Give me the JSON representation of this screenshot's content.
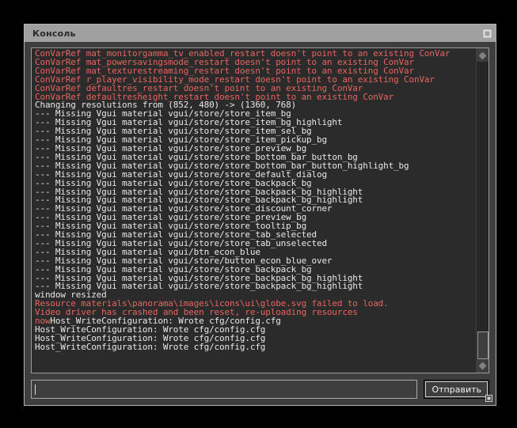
{
  "window": {
    "title": "Консоль",
    "titlebar_color": "#a0a0a0",
    "body_color": "#3e3e3e",
    "log_bg_color": "#2b2b2b",
    "error_color": "#e8645f",
    "text_color": "#e8e8e8",
    "restore_button_icon": "restore-window-icon",
    "resize_grip_icon": "resize-grip-icon"
  },
  "log": {
    "lines": [
      {
        "text": "ConVarRef mat_monitorgamma_tv_enabled_restart doesn't point to an existing ConVar",
        "type": "error"
      },
      {
        "text": "ConVarRef mat_powersavingsmode_restart doesn't point to an existing ConVar",
        "type": "error"
      },
      {
        "text": "ConVarRef mat_texturestreaming_restart doesn't point to an existing ConVar",
        "type": "error"
      },
      {
        "text": "ConVarRef r_player_visibility_mode_restart doesn't point to an existing ConVar",
        "type": "error"
      },
      {
        "text": "ConVarRef defaultres_restart doesn't point to an existing ConVar",
        "type": "error"
      },
      {
        "text": "ConVarRef defaultresheight_restart doesn't point to an existing ConVar",
        "type": "error"
      },
      {
        "text": "Changing resolutions from (852, 480) -> (1360, 768)",
        "type": "normal"
      },
      {
        "text": "--- Missing Vgui material vgui/store/store_item_bg",
        "type": "normal"
      },
      {
        "text": "--- Missing Vgui material vgui/store/store_item_bg_highlight",
        "type": "normal"
      },
      {
        "text": "--- Missing Vgui material vgui/store/store_item_sel_bg",
        "type": "normal"
      },
      {
        "text": "--- Missing Vgui material vgui/store/store_item_pickup_bg",
        "type": "normal"
      },
      {
        "text": "--- Missing Vgui material vgui/store/store_preview_bg",
        "type": "normal"
      },
      {
        "text": "--- Missing Vgui material vgui/store/store_bottom_bar_button_bg",
        "type": "normal"
      },
      {
        "text": "--- Missing Vgui material vgui/store/store_bottom_bar_button_highlight_bg",
        "type": "normal"
      },
      {
        "text": "--- Missing Vgui material vgui/store/store_default_dialog",
        "type": "normal"
      },
      {
        "text": "--- Missing Vgui material vgui/store/store_backpack_bg",
        "type": "normal"
      },
      {
        "text": "--- Missing Vgui material vgui/store/store_backpack_bg_highlight",
        "type": "normal"
      },
      {
        "text": "--- Missing Vgui material vgui/store/store_backpack_bg_highlight",
        "type": "normal"
      },
      {
        "text": "--- Missing Vgui material vgui/store/store_discount_corner",
        "type": "normal"
      },
      {
        "text": "--- Missing Vgui material vgui/store/store_preview_bg",
        "type": "normal"
      },
      {
        "text": "--- Missing Vgui material vgui/store/store_tooltip_bg",
        "type": "normal"
      },
      {
        "text": "--- Missing Vgui material vgui/store/store_tab_selected",
        "type": "normal"
      },
      {
        "text": "--- Missing Vgui material vgui/store/store_tab_unselected",
        "type": "normal"
      },
      {
        "text": "--- Missing Vgui material vgui/btn_econ_blue",
        "type": "normal"
      },
      {
        "text": "--- Missing Vgui material vgui/store/button_econ_blue_over",
        "type": "normal"
      },
      {
        "text": "--- Missing Vgui material vgui/store/store_backpack_bg",
        "type": "normal"
      },
      {
        "text": "--- Missing Vgui material vgui/store/store_backpack_bg_highlight",
        "type": "normal"
      },
      {
        "text": "--- Missing Vgui material vgui/store/store_backpack_bg_highlight",
        "type": "normal"
      },
      {
        "text": "window resized",
        "type": "normal"
      },
      {
        "text": "Resource materials\\panorama\\images\\icons\\ui\\globe.svg failed to load.",
        "type": "error"
      },
      {
        "text": "Video driver has crashed and been reset, re-uploading resources",
        "type": "error"
      },
      {
        "segments": [
          {
            "text": "now",
            "type": "error"
          },
          {
            "text": "Host_WriteConfiguration: Wrote cfg/config.cfg",
            "type": "normal"
          }
        ]
      },
      {
        "text": "Host_WriteConfiguration: Wrote cfg/config.cfg",
        "type": "normal"
      },
      {
        "text": "Host_WriteConfiguration: Wrote cfg/config.cfg",
        "type": "normal"
      },
      {
        "text": "Host_WriteConfiguration: Wrote cfg/config.cfg",
        "type": "normal"
      }
    ]
  },
  "scrollbar": {
    "up_icon": "scroll-up-icon",
    "down_icon": "scroll-down-icon",
    "thumb_position": "bottom"
  },
  "input": {
    "value": "",
    "placeholder": ""
  },
  "submit": {
    "label": "Отправить"
  }
}
